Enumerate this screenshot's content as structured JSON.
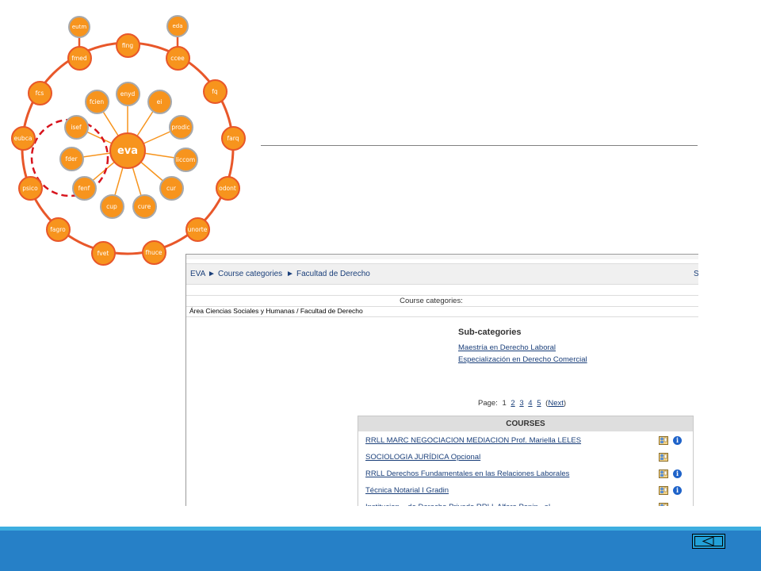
{
  "diagram": {
    "center": "eva",
    "outer_ring": [
      "fing",
      "ccee",
      "fq",
      "farq",
      "odont",
      "unorte",
      "fhuce",
      "fvet",
      "fagro",
      "psico",
      "eubca",
      "fcs",
      "fmed"
    ],
    "inner_ring": [
      "enyd",
      "ei",
      "prodic",
      "liccom",
      "cur",
      "cure",
      "cup",
      "fenf",
      "fder",
      "isef",
      "fcien"
    ],
    "top_nodes": [
      "eutm",
      "eda"
    ]
  },
  "breadcrumb": {
    "root": "EVA",
    "separator": "►",
    "course_categories": "Course categories",
    "current": "Facultad de Derecho",
    "right_fragment": "S"
  },
  "category": {
    "header": "Course categories:",
    "path": "Área Ciencias Sociales y Humanas / Facultad de Derecho"
  },
  "subcategories": {
    "title": "Sub-categories",
    "items": [
      "Maestría en Derecho Laboral",
      "Especialización en Derecho Comercial"
    ]
  },
  "pager": {
    "label": "Page:",
    "current": "1",
    "pages": [
      "2",
      "3",
      "4",
      "5"
    ],
    "open_paren": "(",
    "next": "Next",
    "close_paren": ")"
  },
  "courses": {
    "header": "COURSES",
    "items": [
      {
        "name": "RRLL MARC NEGOCIACION MEDIACION Prof. Mariella LELES",
        "info": true
      },
      {
        "name": "SOCIOLOGIA JURÍDICA Opcional",
        "info": false
      },
      {
        "name": "RRLL Derechos Fundamentales en las Relaciones Laborales",
        "info": true
      },
      {
        "name": "Técnica Notarial I Gradin",
        "info": true
      },
      {
        "name": "Institucion... de Derecho Privado RRLL Alfaro Penin...al",
        "info": false
      }
    ],
    "info_glyph": "i"
  },
  "colors": {
    "node_fill": "#f7941d",
    "node_outer_border": "#e8572a",
    "node_inner_border": "#a7a9ac",
    "spoke": "#f7941d",
    "dashed_highlight": "#d7141d",
    "footer": "#2680c7",
    "footer_accent": "#3daee0",
    "link": "#1a3f7a"
  },
  "icons": {
    "breadcrumb_separator": "triangle-right-icon",
    "teacher": "teacher-icon",
    "info": "info-icon",
    "back": "triangle-left-icon"
  }
}
